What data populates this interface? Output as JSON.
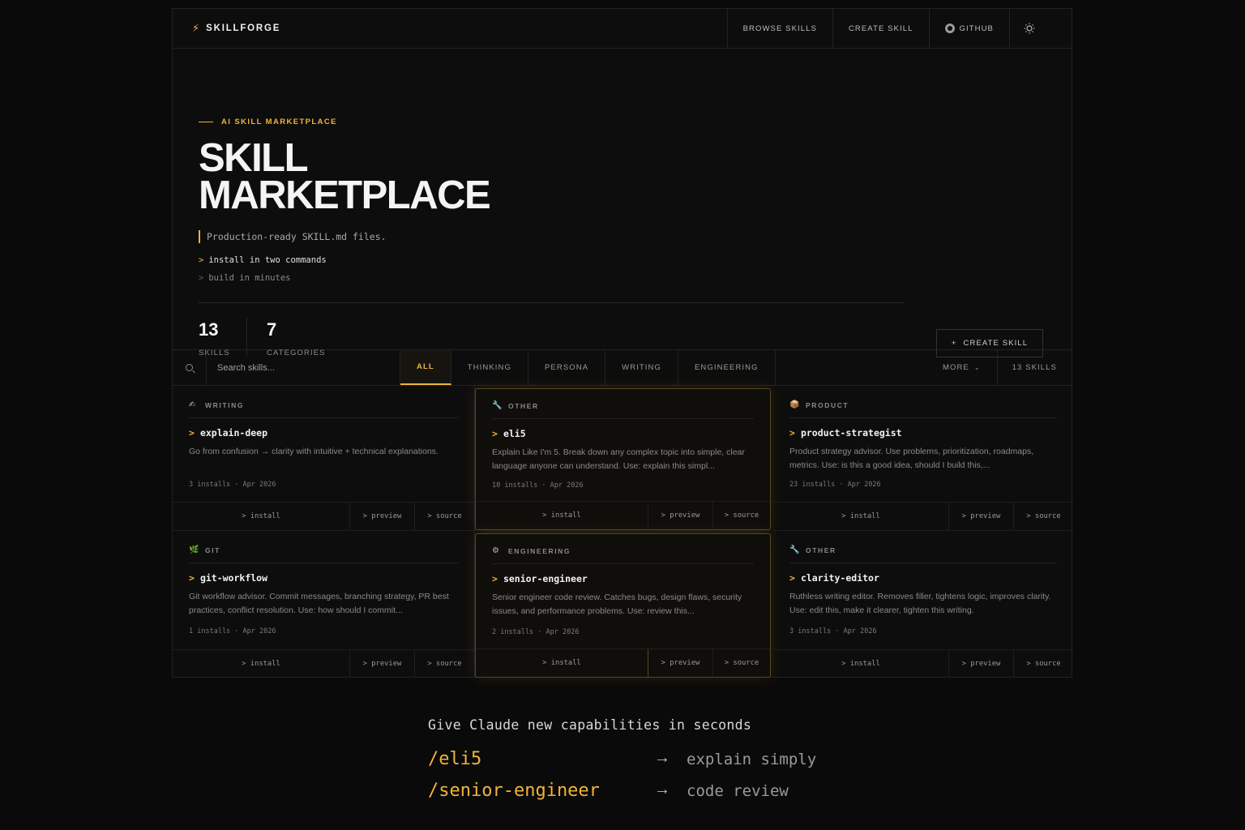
{
  "nav": {
    "logo_icon": "bolt-icon",
    "brand": "SKILLFORGE",
    "items": [
      "BROWSE SKILLS",
      "CREATE SKILL",
      "GITHUB"
    ],
    "theme_icon": "sun-icon"
  },
  "hero": {
    "eyebrow": "AI SKILL MARKETPLACE",
    "title_line1": "SKILL",
    "title_line2": "MARKETPLACE",
    "tagline": "Production-ready SKILL.md files.",
    "cmd1": "install in two commands",
    "cmd2": "build in minutes",
    "stats": [
      {
        "value": "13",
        "label": "SKILLS"
      },
      {
        "value": "7",
        "label": "CATEGORIES"
      }
    ],
    "create_button": "CREATE SKILL"
  },
  "filters": {
    "search_placeholder": "Search skills...",
    "tabs": [
      "ALL",
      "THINKING",
      "PERSONA",
      "WRITING",
      "ENGINEERING"
    ],
    "active_tab": "ALL",
    "more": "MORE",
    "count": "13 SKILLS"
  },
  "cards": [
    {
      "category": "WRITING",
      "icon": "writing-hand-icon",
      "name": "explain-deep",
      "description": "Go from confusion → clarity with intuitive + technical explanations.",
      "installs": "3 installs",
      "date": "Apr 2026",
      "install": "install",
      "preview": "preview",
      "source": "source"
    },
    {
      "category": "OTHER",
      "icon": "wrench-icon",
      "name": "eli5",
      "description": "Explain Like I'm 5. Break down any complex topic into simple, clear language anyone can understand. Use: explain this simpl...",
      "installs": "10 installs",
      "date": "Apr 2026",
      "install": "install",
      "preview": "preview",
      "source": "source"
    },
    {
      "category": "PRODUCT",
      "icon": "package-icon",
      "name": "product-strategist",
      "description": "Product strategy advisor. Use problems, prioritization, roadmaps, metrics. Use: is this a good idea, should I build this,...",
      "installs": "23 installs",
      "date": "Apr 2026",
      "install": "install",
      "preview": "preview",
      "source": "source"
    },
    {
      "category": "GIT",
      "icon": "herb-icon",
      "name": "git-workflow",
      "description": "Git workflow advisor. Commit messages, branching strategy, PR best practices, conflict resolution. Use: how should I commit...",
      "installs": "1 installs",
      "date": "Apr 2026",
      "install": "install",
      "preview": "preview",
      "source": "source"
    },
    {
      "category": "ENGINEERING",
      "icon": "gear-icon",
      "name": "senior-engineer",
      "description": "Senior engineer code review. Catches bugs, design flaws, security issues, and performance problems. Use: review this...",
      "installs": "2 installs",
      "date": "Apr 2026",
      "install": "install",
      "preview": "preview",
      "source": "source"
    },
    {
      "category": "OTHER",
      "icon": "wrench-icon",
      "name": "clarity-editor",
      "description": "Ruthless writing editor. Removes filler, tightens logic, improves clarity. Use: edit this, make it clearer, tighten this writing.",
      "installs": "3 installs",
      "date": "Apr 2026",
      "install": "install",
      "preview": "preview",
      "source": "source"
    }
  ],
  "footer": {
    "headline": "Give Claude new capabilities in seconds",
    "commands": [
      {
        "cmd": "/eli5",
        "desc": "explain simply"
      },
      {
        "cmd": "/senior-engineer",
        "desc": "code review"
      }
    ]
  },
  "colors": {
    "accent": "#f0b33c",
    "background": "#0a0a0a"
  }
}
